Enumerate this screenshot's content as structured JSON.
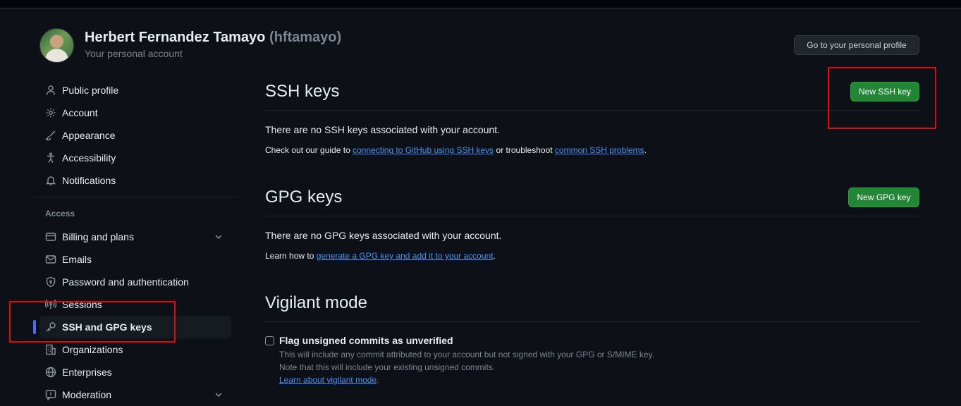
{
  "header": {
    "name": "Herbert Fernandez Tamayo",
    "handle": "(hftamayo)",
    "subtitle": "Your personal account",
    "profile_button": "Go to your personal profile"
  },
  "sidebar": {
    "items_top": [
      {
        "label": "Public profile",
        "icon": "person-icon"
      },
      {
        "label": "Account",
        "icon": "gear-icon"
      },
      {
        "label": "Appearance",
        "icon": "paintbrush-icon"
      },
      {
        "label": "Accessibility",
        "icon": "accessibility-icon"
      },
      {
        "label": "Notifications",
        "icon": "bell-icon"
      }
    ],
    "section_access": "Access",
    "items_access": [
      {
        "label": "Billing and plans",
        "icon": "credit-card-icon",
        "expandable": true
      },
      {
        "label": "Emails",
        "icon": "mail-icon"
      },
      {
        "label": "Password and authentication",
        "icon": "shield-lock-icon"
      },
      {
        "label": "Sessions",
        "icon": "broadcast-icon"
      },
      {
        "label": "SSH and GPG keys",
        "icon": "key-icon",
        "active": true
      },
      {
        "label": "Organizations",
        "icon": "organization-icon"
      },
      {
        "label": "Enterprises",
        "icon": "globe-icon"
      },
      {
        "label": "Moderation",
        "icon": "report-icon",
        "expandable": true
      }
    ]
  },
  "ssh": {
    "title": "SSH keys",
    "new_button": "New SSH key",
    "empty_text": "There are no SSH keys associated with your account.",
    "guide_prefix": "Check out our guide to ",
    "guide_link": "connecting to GitHub using SSH keys",
    "guide_middle": " or troubleshoot ",
    "guide_link2": "common SSH problems",
    "guide_suffix": "."
  },
  "gpg": {
    "title": "GPG keys",
    "new_button": "New GPG key",
    "empty_text": "There are no GPG keys associated with your account.",
    "learn_prefix": "Learn how to ",
    "learn_link": "generate a GPG key and add it to your account",
    "learn_suffix": "."
  },
  "vigilant": {
    "title": "Vigilant mode",
    "checkbox_label": "Flag unsigned commits as unverified",
    "checked": false,
    "desc1": "This will include any commit attributed to your account but not signed with your GPG or S/MIME key.",
    "desc2": "Note that this will include your existing unsigned commits.",
    "learn_link": "Learn about vigilant mode",
    "learn_suffix": "."
  },
  "colors": {
    "background": "#0d1117",
    "primary_button": "#238636",
    "link": "#4493f8",
    "active_indicator": "#4f6bf3",
    "highlight": "#e00b0b"
  }
}
